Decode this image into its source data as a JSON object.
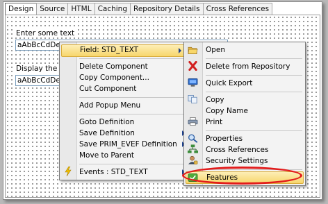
{
  "tabs": [
    "Design",
    "Source",
    "HTML",
    "Caching",
    "Repository Details",
    "Cross References"
  ],
  "canvas": {
    "label1": "Enter some text",
    "field1": "aAbBcCdDeEfF",
    "label2": "Display the Res",
    "field2": "aAbBcCdDeEfF"
  },
  "left_menu": {
    "header": "Field: STD_TEXT",
    "items": {
      "delete_component": "Delete Component",
      "copy_component": "Copy Component...",
      "cut_component": "Cut Component",
      "add_popup_menu": "Add Popup Menu",
      "goto_definition": "Goto Definition",
      "save_definition": "Save Definition",
      "save_prim": "Save PRIM_EVEF Definition",
      "move_to_parent": "Move to Parent",
      "events": "Events : STD_TEXT"
    }
  },
  "right_menu": {
    "open": "Open",
    "delete_from_repository": "Delete from Repository",
    "quick_export": "Quick Export",
    "copy": "Copy",
    "copy_name": "Copy Name",
    "print": "Print",
    "properties": "Properties",
    "cross_references": "Cross References",
    "security_settings": "Security Settings",
    "features": "Features"
  },
  "colors": {
    "highlight": "#f7d66c",
    "oval": "#e21b1b"
  }
}
